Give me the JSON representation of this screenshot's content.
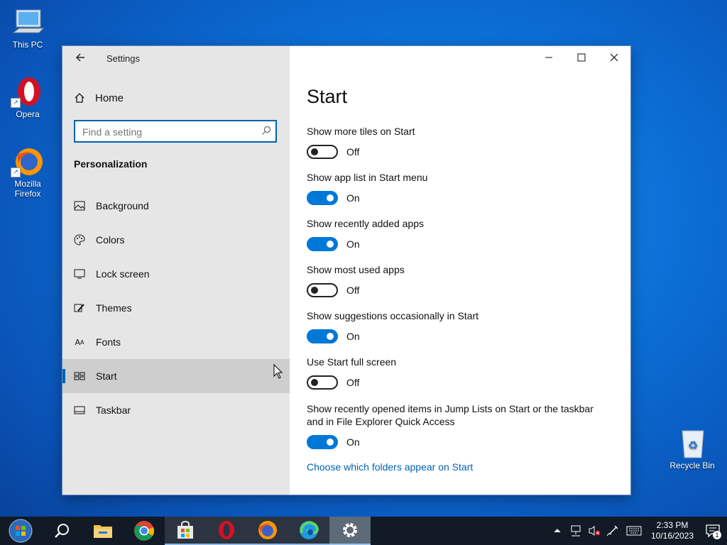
{
  "desktop": {
    "icons": [
      {
        "label": "This PC"
      },
      {
        "label": "Opera"
      },
      {
        "label": "Mozilla Firefox"
      },
      {
        "label": "Recycle Bin"
      }
    ]
  },
  "window": {
    "app_title": "Settings",
    "home_label": "Home",
    "search_placeholder": "Find a setting",
    "section_title": "Personalization",
    "nav_items": [
      {
        "label": "Background",
        "icon": "picture-icon"
      },
      {
        "label": "Colors",
        "icon": "palette-icon"
      },
      {
        "label": "Lock screen",
        "icon": "monitor-icon"
      },
      {
        "label": "Themes",
        "icon": "brush-icon"
      },
      {
        "label": "Fonts",
        "icon": "font-icon"
      },
      {
        "label": "Start",
        "icon": "start-icon",
        "active": true
      },
      {
        "label": "Taskbar",
        "icon": "taskbar-icon"
      }
    ]
  },
  "main": {
    "title": "Start",
    "settings": [
      {
        "label": "Show more tiles on Start",
        "state": "Off"
      },
      {
        "label": "Show app list in Start menu",
        "state": "On"
      },
      {
        "label": "Show recently added apps",
        "state": "On"
      },
      {
        "label": "Show most used apps",
        "state": "Off"
      },
      {
        "label": "Show suggestions occasionally in Start",
        "state": "On"
      },
      {
        "label": "Use Start full screen",
        "state": "Off"
      },
      {
        "label": "Show recently opened items in Jump Lists on Start or the taskbar and in File Explorer Quick Access",
        "state": "On"
      }
    ],
    "link": "Choose which folders appear on Start"
  },
  "taskbar": {
    "apps": [
      "start-orb-icon",
      "search-icon",
      "file-explorer-icon",
      "chrome-icon",
      "store-icon",
      "opera-icon",
      "firefox-icon",
      "edge-icon",
      "settings-gear-icon"
    ],
    "clock_time": "2:33 PM",
    "clock_date": "10/16/2023",
    "notification_count": "1"
  },
  "colors": {
    "accent": "#0078d7",
    "sidebar_bg": "#e6e6e6",
    "link": "#0063b1"
  }
}
